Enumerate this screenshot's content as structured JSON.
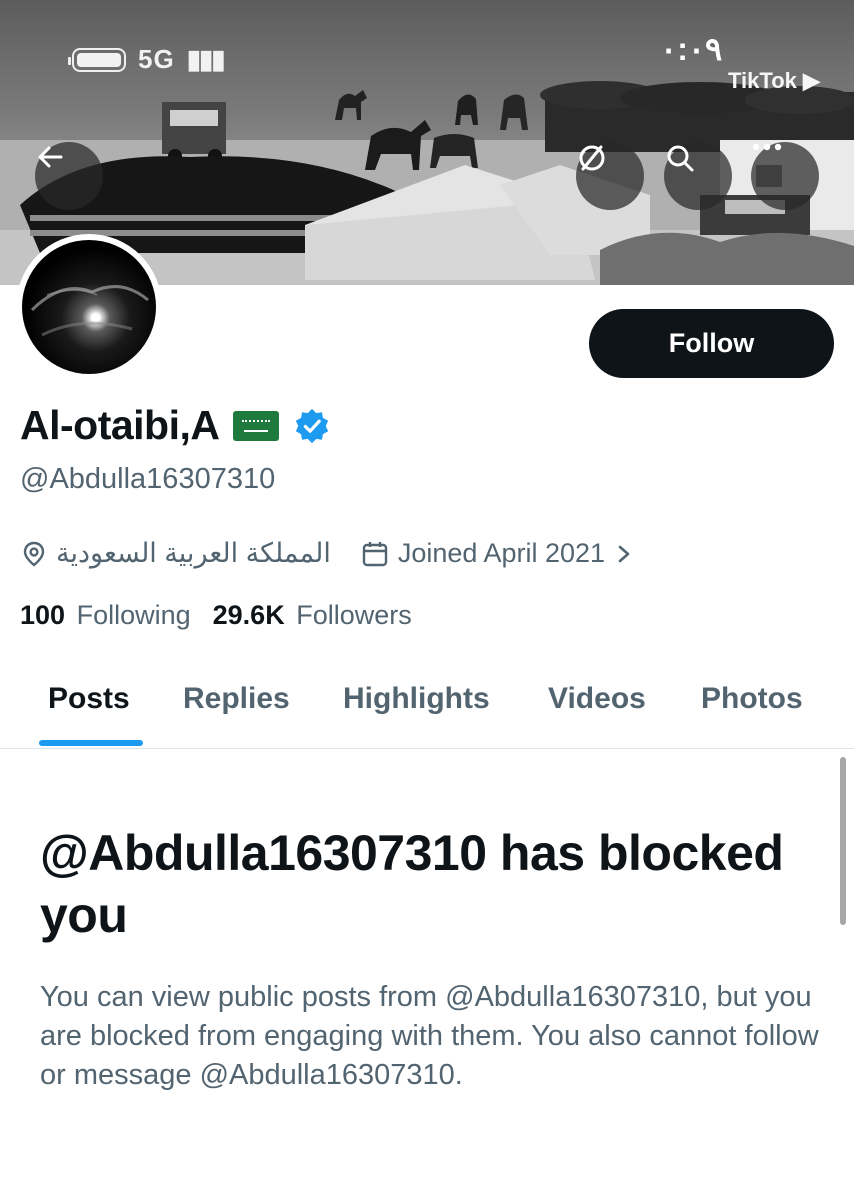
{
  "status_bar": {
    "network": "5G",
    "time": "٠:٠٩",
    "source_app": "TikTok ▶"
  },
  "header": {
    "back_icon": "arrow-left-icon",
    "actions": [
      {
        "icon": "block-icon"
      },
      {
        "icon": "search-icon"
      },
      {
        "icon": "more-icon"
      }
    ]
  },
  "profile": {
    "display_name": "Al-otaibi,A",
    "flag_icon": "saudi-flag-icon",
    "verified_color": "#1d9bf0",
    "handle": "@Abdulla16307310",
    "location": "المملكة العربية السعودية",
    "joined": "Joined April 2021",
    "following_count": "100",
    "following_label": "Following",
    "followers_count": "29.6K",
    "followers_label": "Followers",
    "follow_button": "Follow"
  },
  "tabs": [
    {
      "label": "Posts",
      "active": true
    },
    {
      "label": "Replies",
      "active": false
    },
    {
      "label": "Highlights",
      "active": false
    },
    {
      "label": "Videos",
      "active": false
    },
    {
      "label": "Photos",
      "active": false
    }
  ],
  "blocked_notice": {
    "title": "@Abdulla16307310 has blocked you",
    "body": "You can view public posts from @Abdulla16307310, but you are blocked from engaging with them. You also cannot follow or message @Abdulla16307310."
  },
  "colors": {
    "accent": "#1d9bf0",
    "text_primary": "#0f1419",
    "text_secondary": "#536471",
    "button_dark": "#0f1419"
  }
}
